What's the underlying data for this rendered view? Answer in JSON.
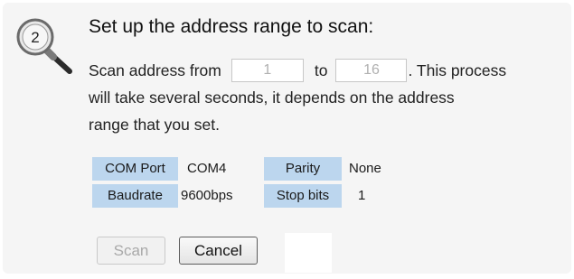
{
  "step": {
    "icon": "magnifier-step-icon",
    "number": "2"
  },
  "title": "Set up the address range to scan:",
  "scan_range": {
    "prefix": "Scan address from",
    "from_value": "1",
    "between": "to",
    "to_value": "16",
    "suffix": ". This process",
    "line2": "will take several seconds, it depends on the address",
    "line3": "range that you set."
  },
  "settings": {
    "com_port_label": "COM Port",
    "com_port_value": "COM4",
    "parity_label": "Parity",
    "parity_value": "None",
    "baudrate_label": "Baudrate",
    "baudrate_value": "9600bps",
    "stop_bits_label": "Stop bits",
    "stop_bits_value": "1"
  },
  "buttons": {
    "scan_label": "Scan",
    "scan_enabled": false,
    "cancel_label": "Cancel"
  },
  "colors": {
    "panel_bg": "#f5f5f5",
    "label_bg": "#bcd6ee",
    "disabled_text": "#a9a9a9"
  }
}
